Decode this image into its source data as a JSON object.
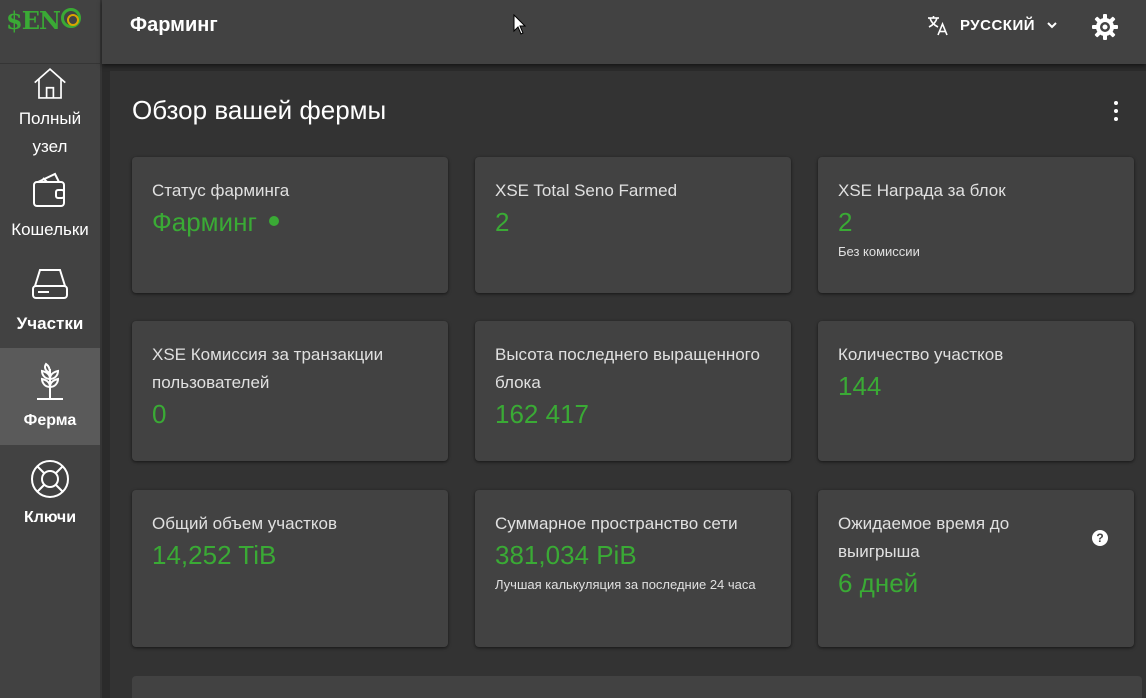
{
  "logo": {
    "text": "$EN"
  },
  "sidebar": {
    "items": [
      {
        "label": "Полный узел",
        "icon": "home-icon"
      },
      {
        "label": "Кошельки",
        "icon": "wallet-icon"
      },
      {
        "label": "Участки",
        "icon": "hard-drive-icon"
      },
      {
        "label": "Ферма",
        "icon": "sprout-icon"
      },
      {
        "label": "Ключи",
        "icon": "lifebuoy-icon"
      }
    ]
  },
  "header": {
    "title": "Фарминг",
    "language": "РУССКИЙ",
    "language_icon": "translate-icon",
    "settings_icon": "gear-icon"
  },
  "main": {
    "title": "Обзор вашей фермы",
    "cards": [
      {
        "title": "Статус фарминга",
        "value": "Фарминг",
        "note": ""
      },
      {
        "title": "XSE Total Seno Farmed",
        "value": "2",
        "note": ""
      },
      {
        "title": "XSE Награда за блок",
        "value": "2",
        "note": "Без комиссии"
      },
      {
        "title": "XSE Комиссия за транзакции пользователей",
        "value": "0",
        "note": ""
      },
      {
        "title": "Высота последнего выращенного блока",
        "value": "162 417",
        "note": ""
      },
      {
        "title": "Количество участков",
        "value": "144",
        "note": ""
      },
      {
        "title": "Общий объем участков",
        "value": "14,252 TiB",
        "note": ""
      },
      {
        "title": "Суммарное пространство сети",
        "value": "381,034 PiB",
        "note": "Лучшая калькуляция за последние 24 часа"
      },
      {
        "title": "Ожидаемое время до выигрыша",
        "value": "6 дней",
        "note": ""
      }
    ],
    "help_icon": "?"
  },
  "colors": {
    "accent": "#3aaa35",
    "card": "#424242",
    "background": "#333333"
  }
}
